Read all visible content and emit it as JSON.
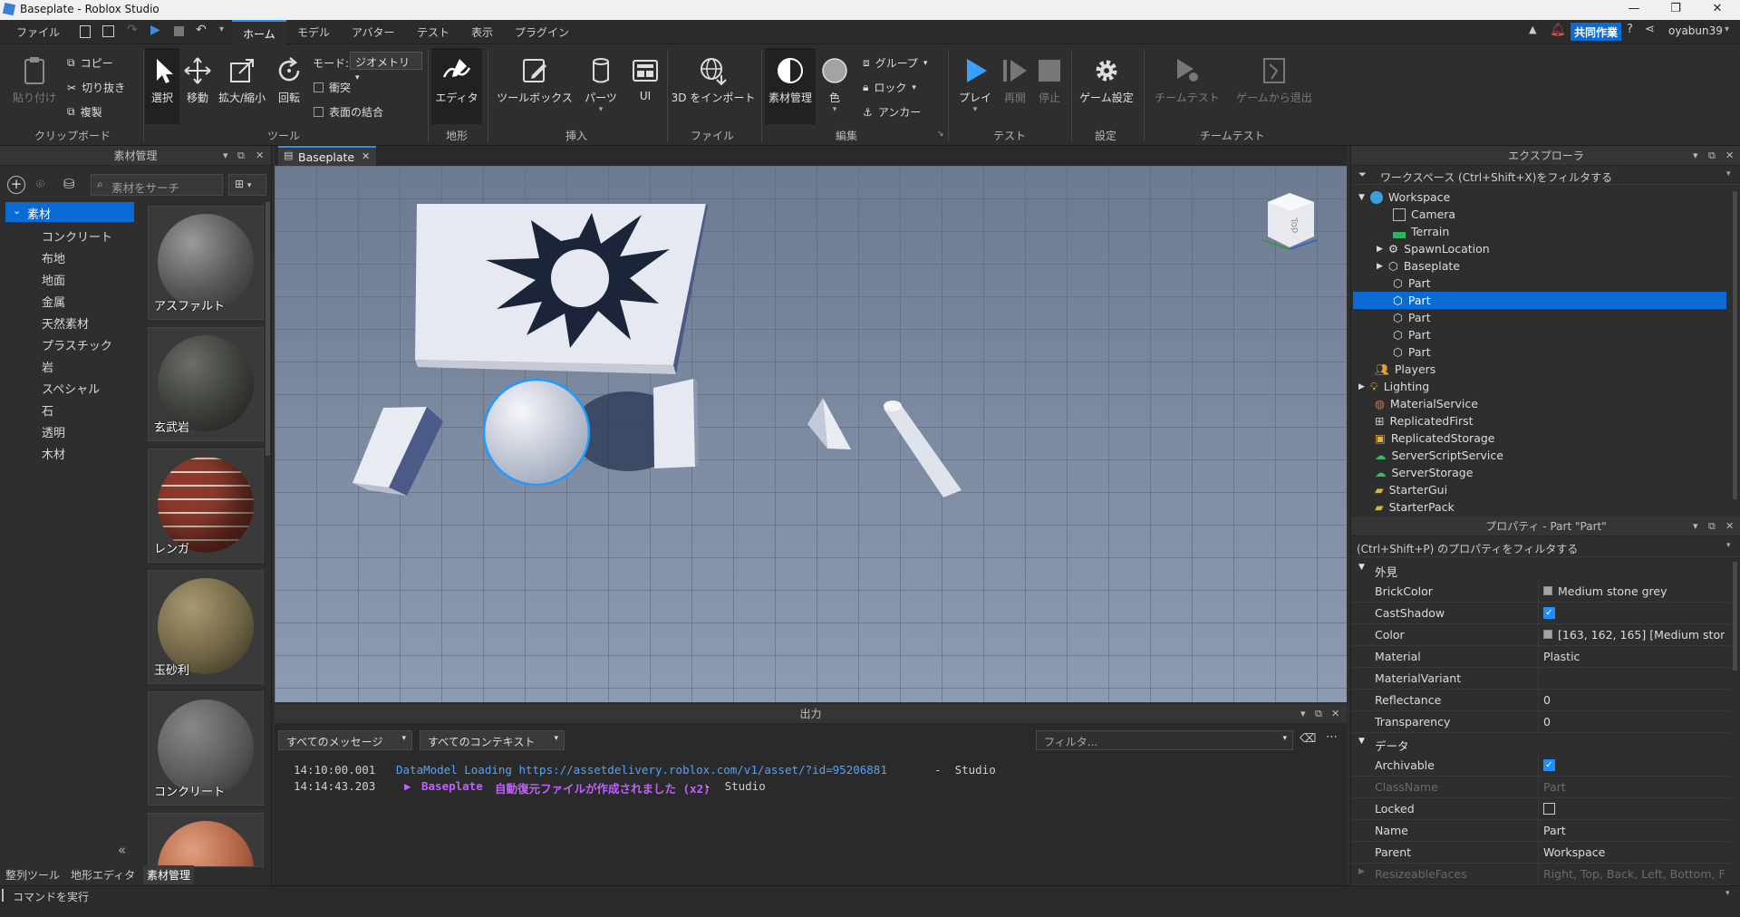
{
  "window": {
    "title": "Baseplate - Roblox Studio"
  },
  "menu": {
    "file": "ファイル",
    "tabs": [
      "ホーム",
      "モデル",
      "アバター",
      "テスト",
      "表示",
      "プラグイン"
    ],
    "collab": "共同作業",
    "user": "oyabun39"
  },
  "ribbon": {
    "paste": "貼り付け",
    "copy": "コピー",
    "cut": "切り抜き",
    "duplicate": "複製",
    "clipboard_group": "クリップボード",
    "select": "選択",
    "move": "移動",
    "scale": "拡大/縮小",
    "rotate": "回転",
    "mode_label": "モード:",
    "mode_value": "ジオメトリ",
    "collision": "衝突",
    "join_surfaces": "表面の結合",
    "tools_group": "ツール",
    "editor": "エディタ",
    "terrain_group": "地形",
    "toolbox": "ツールボックス",
    "parts": "パーツ",
    "ui": "UI",
    "insert_group": "挿入",
    "import3d": "3D をインポート",
    "file_group": "ファイル",
    "material_manager": "素材管理",
    "color": "色",
    "group": "グループ",
    "lock": "ロック",
    "anchor": "アンカー",
    "edit_group": "編集",
    "play": "プレイ",
    "resume": "再開",
    "stop": "停止",
    "test_group": "テスト",
    "game_settings": "ゲーム設定",
    "settings_group": "設定",
    "team_test": "チームテスト",
    "exit_game": "ゲームから退出",
    "team_test_group": "チームテスト"
  },
  "materials_panel": {
    "title": "素材管理",
    "search_placeholder": "素材をサーチ",
    "root": "素材",
    "categories": [
      "コンクリート",
      "布地",
      "地面",
      "金属",
      "天然素材",
      "プラスチック",
      "岩",
      "スペシャル",
      "石",
      "透明",
      "木材"
    ],
    "tiles": [
      "アスファルト",
      "玄武岩",
      "レンガ",
      "玉砂利",
      "コンクリート"
    ]
  },
  "bottom_tabs": [
    "整列ツール",
    "地形エディタ",
    "素材管理"
  ],
  "viewport": {
    "tab": "Baseplate",
    "cube_label": "Top"
  },
  "output": {
    "title": "出力",
    "filter_messages": "すべてのメッセージ",
    "filter_contexts": "すべてのコンテキスト",
    "filter_placeholder": "フィルタ...",
    "line1_time": "14:10:00.001",
    "line1_msg": "DataModel Loading https://assetdelivery.roblox.com/v1/asset/?id=95206881",
    "line1_src": "-  Studio",
    "line2_time": "14:14:43.203",
    "line2_place": "Baseplate",
    "line2_msg": "自動復元ファイルが作成されました (x2)",
    "line2_src": "-  Studio"
  },
  "explorer": {
    "title": "エクスプローラ",
    "filter": "ワークスペース (Ctrl+Shift+X)をフィルタする",
    "items": [
      "Workspace",
      "Camera",
      "Terrain",
      "SpawnLocation",
      "Baseplate",
      "Part",
      "Part",
      "Part",
      "Part",
      "Part",
      "Players",
      "Lighting",
      "MaterialService",
      "ReplicatedFirst",
      "ReplicatedStorage",
      "ServerScriptService",
      "ServerStorage",
      "StarterGui",
      "StarterPack"
    ]
  },
  "properties": {
    "title": "プロパティ - Part \"Part\"",
    "filter": "(Ctrl+Shift+P) のプロパティをフィルタする",
    "sec_appearance": "外見",
    "sec_data": "データ",
    "brickcolor_n": "BrickColor",
    "brickcolor_v": "Medium stone grey",
    "castshadow_n": "CastShadow",
    "color_n": "Color",
    "color_v": "[163, 162, 165] [Medium ston...",
    "material_n": "Material",
    "material_v": "Plastic",
    "materialvariant_n": "MaterialVariant",
    "reflectance_n": "Reflectance",
    "reflectance_v": "0",
    "transparency_n": "Transparency",
    "transparency_v": "0",
    "archivable_n": "Archivable",
    "classname_n": "ClassName",
    "classname_v": "Part",
    "locked_n": "Locked",
    "name_n": "Name",
    "name_v": "Part",
    "parent_n": "Parent",
    "parent_v": "Workspace",
    "resizable_n": "ResizeableFaces",
    "resizable_v": "Right, Top, Back, Left, Bottom, Fr..."
  },
  "status": {
    "command_placeholder": "コマンドを実行"
  },
  "colors": {
    "accent": "#3a8fe0",
    "selection": "#0a6ad6",
    "link": "#4fa3ff",
    "magenta": "#c060ff"
  }
}
